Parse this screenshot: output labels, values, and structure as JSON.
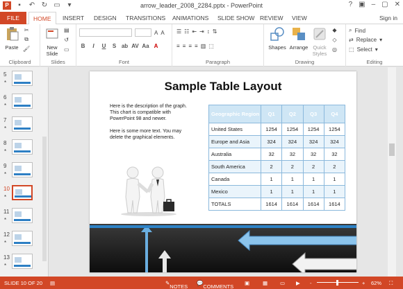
{
  "window": {
    "title": "arrow_leader_2008_2284.pptx - PowerPoint",
    "help": "?",
    "signin": "Sign in"
  },
  "tabs": [
    "FILE",
    "HOME",
    "INSERT",
    "DESIGN",
    "TRANSITIONS",
    "ANIMATIONS",
    "SLIDE SHOW",
    "REVIEW",
    "VIEW"
  ],
  "active_tab": "HOME",
  "ribbon": {
    "clipboard": {
      "paste": "Paste",
      "label": "Clipboard"
    },
    "slides": {
      "new_slide_line1": "New",
      "new_slide_line2": "Slide",
      "label": "Slides"
    },
    "font": {
      "label": "Font"
    },
    "paragraph": {
      "label": "Paragraph"
    },
    "drawing": {
      "shapes": "Shapes",
      "arrange": "Arrange",
      "quick_styles_1": "Quick",
      "quick_styles_2": "Styles",
      "label": "Drawing"
    },
    "editing": {
      "find": "Find",
      "replace": "Replace",
      "select": "Select",
      "label": "Editing"
    }
  },
  "thumbnails": [
    {
      "num": "5",
      "star": "*"
    },
    {
      "num": "6",
      "star": "*"
    },
    {
      "num": "7",
      "star": "*"
    },
    {
      "num": "8",
      "star": "*"
    },
    {
      "num": "9",
      "star": "*"
    },
    {
      "num": "10",
      "star": "*"
    },
    {
      "num": "11",
      "star": "*"
    },
    {
      "num": "12",
      "star": "*"
    },
    {
      "num": "13",
      "star": "*"
    }
  ],
  "slide": {
    "title": "Sample Table Layout",
    "desc1": "Here is the description of the graph.  This chart is compatible with PowerPoint 98 and newer.",
    "desc2": "Here is some more text.  You may delete the graphical elements.",
    "table": {
      "headers": [
        "Geographic Region",
        "Q1",
        "Q2",
        "Q3",
        "Q4"
      ],
      "rows": [
        [
          "United States",
          "1254",
          "1254",
          "1254",
          "1254"
        ],
        [
          "Europe and Asia",
          "324",
          "324",
          "324",
          "324"
        ],
        [
          "Australia",
          "32",
          "32",
          "32",
          "32"
        ],
        [
          "South America",
          "2",
          "2",
          "2",
          "2"
        ],
        [
          "Canada",
          "1",
          "1",
          "1",
          "1"
        ],
        [
          "Mexico",
          "1",
          "1",
          "1",
          "1"
        ],
        [
          "TOTALS",
          "1614",
          "1614",
          "1614",
          "1614"
        ]
      ]
    }
  },
  "status": {
    "slide": "SLIDE 10 OF 20",
    "notes": "NOTES",
    "comments": "COMMENTS",
    "zoom": "62%",
    "minus": "-",
    "plus": "+"
  },
  "colors": {
    "accent": "#d24726",
    "table_header": "#cfe6f5",
    "table_border": "#8ab8dc",
    "blue_bar": "#2d82c6"
  }
}
